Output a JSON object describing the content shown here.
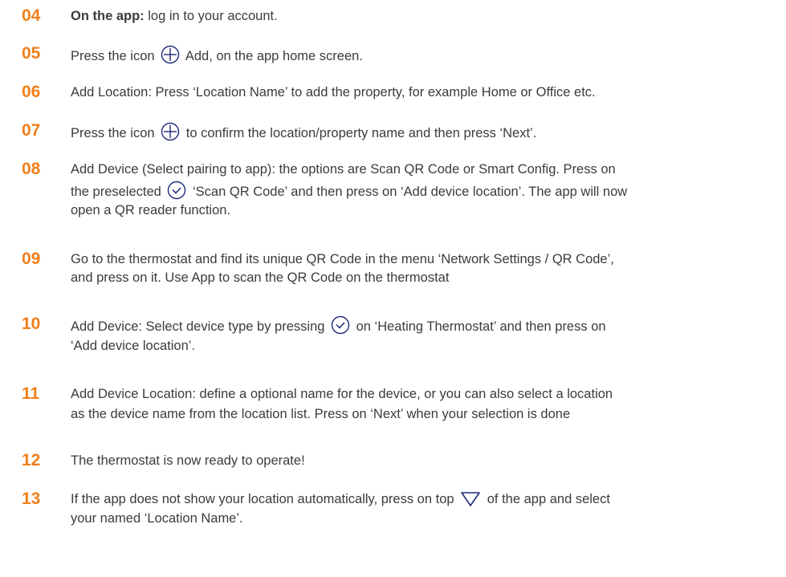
{
  "colors": {
    "accent": "#F07F1A",
    "icon": "#1E2A78",
    "text": "#3B3B3B"
  },
  "steps": [
    {
      "number": "04",
      "bold": "On the app:",
      "lines": [
        " log in to your account."
      ]
    },
    {
      "number": "05",
      "a": "Press the icon",
      "icon": "circle-plus-icon",
      "b": "Add, on the app home screen."
    },
    {
      "number": "06",
      "lines": [
        "Add Location: Press ‘Location Name’ to add the property, for example Home or Office etc."
      ]
    },
    {
      "number": "07",
      "a": "Press the icon",
      "icon": "circle-plus-icon",
      "b": "to confirm the location/property name and then press ‘Next’."
    },
    {
      "number": "08",
      "line1": "Add Device (Select pairing to app): the options are Scan QR Code or Smart Config. Press on",
      "line2a": "the preselected",
      "icon": "circle-check-icon",
      "line2b": "‘Scan QR Code’ and then press on ‘Add device location’. The app will now",
      "line3": "open a QR reader function."
    },
    {
      "number": "09",
      "lines": [
        "Go to the thermostat and find its unique QR Code in the menu ‘Network Settings / QR Code’,",
        "and press on it. Use App to scan the QR Code on the thermostat"
      ]
    },
    {
      "number": "10",
      "line1a": "Add Device: Select device type by pressing",
      "icon": "circle-check-icon",
      "line1b": "on ‘Heating Thermostat’ and then press on",
      "line2": "‘Add device location’."
    },
    {
      "number": "11",
      "lines": [
        "Add Device Location: define a optional name for the device, or you can also select a location",
        "as the device name from the location list. Press on ‘Next’ when your selection is done"
      ]
    },
    {
      "number": "12",
      "lines": [
        "The thermostat is now ready to operate!"
      ]
    },
    {
      "number": "13",
      "line1a": "If the app does not show your location automatically, press on top",
      "icon": "triangle-down-icon",
      "line1b": "of the app and select",
      "line2": "your named ‘Location Name’."
    }
  ]
}
